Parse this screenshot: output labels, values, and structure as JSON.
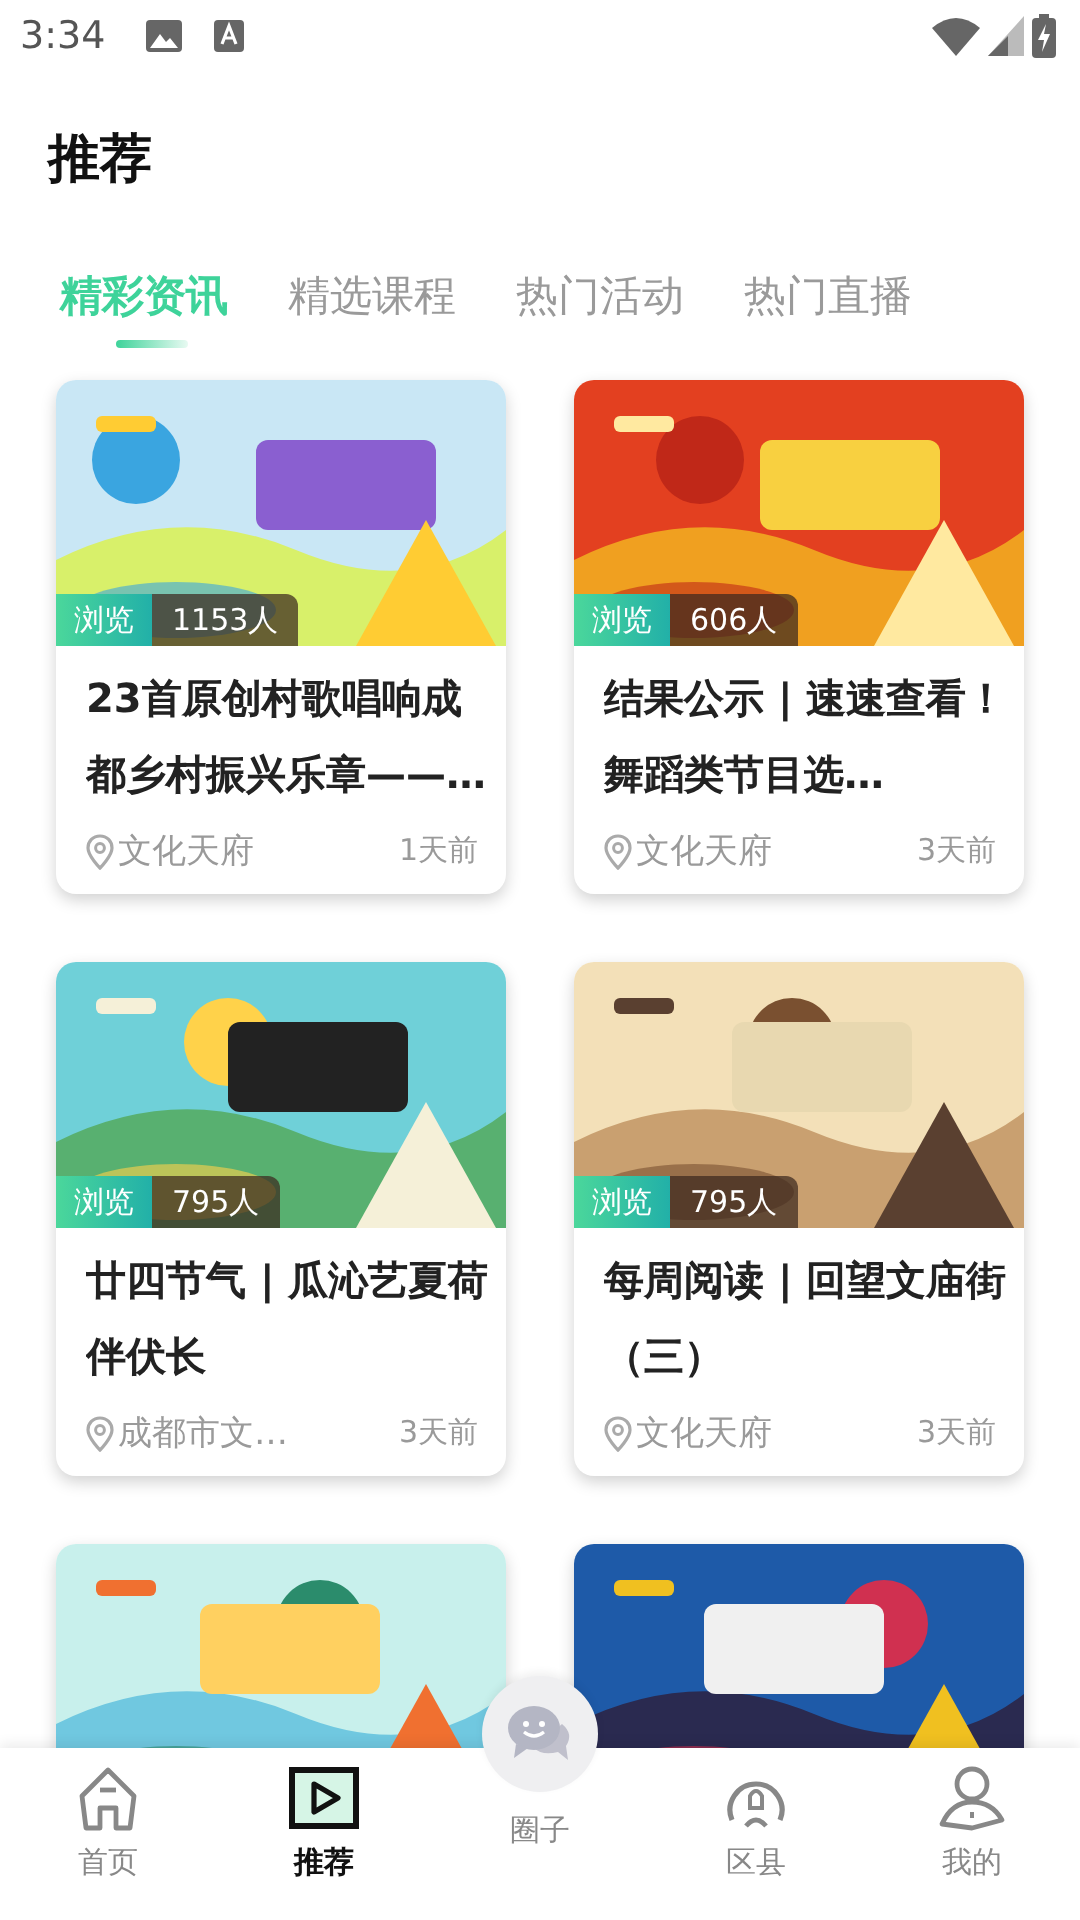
{
  "status_bar": {
    "time": "3:34"
  },
  "page_title": "推荐",
  "tabs": [
    {
      "label": "精彩资讯",
      "selected": true
    },
    {
      "label": "精选课程",
      "selected": false
    },
    {
      "label": "热门活动",
      "selected": false
    },
    {
      "label": "热门直播",
      "selected": false
    }
  ],
  "cards": [
    {
      "kind": "article",
      "views_label": "浏览",
      "views": "1153人",
      "title": "23首原创村歌唱响成都乡村振兴乐章——…",
      "source": "文化天府",
      "time": "1天前"
    },
    {
      "kind": "article",
      "views_label": "浏览",
      "views": "606人",
      "title": "结果公示 | 速速查看！舞蹈类节目选…",
      "source": "文化天府",
      "time": "3天前"
    },
    {
      "kind": "article",
      "views_label": "浏览",
      "views": "795人",
      "title": "廿四节气 | 瓜沁艺夏荷伴伏长",
      "source": "成都市文…",
      "time": "3天前"
    },
    {
      "kind": "article",
      "views_label": "浏览",
      "views": "795人",
      "title": "每周阅读 | 回望文庙街（三）",
      "source": "文化天府",
      "time": "3天前"
    },
    {
      "kind": "picture"
    },
    {
      "kind": "picture"
    }
  ],
  "nav": [
    {
      "label": "首页",
      "selected": false
    },
    {
      "label": "推荐",
      "selected": true
    },
    {
      "label": "圈子",
      "selected": false
    },
    {
      "label": "区县",
      "selected": false
    },
    {
      "label": "我的",
      "selected": false
    }
  ]
}
